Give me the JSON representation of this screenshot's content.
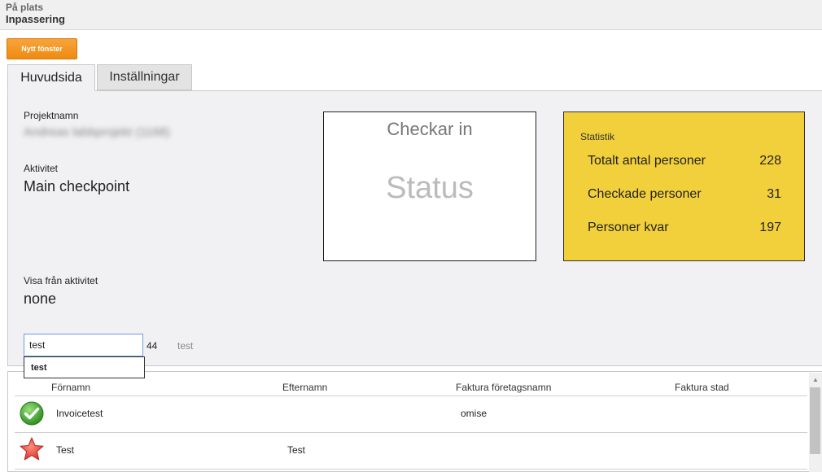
{
  "header": {
    "breadcrumb": "På plats",
    "title": "Inpassering"
  },
  "toolbar": {
    "new_window_label": "Nytt fönster"
  },
  "tabs": [
    {
      "label": "Huvudsida",
      "active": true
    },
    {
      "label": "Inställningar",
      "active": false
    }
  ],
  "project": {
    "label": "Projektnamn",
    "value": "Andreas labbprojekt (1168)"
  },
  "activity": {
    "label": "Aktivitet",
    "value": "Main checkpoint"
  },
  "show_from": {
    "label": "Visa från aktivitet",
    "value": "none"
  },
  "status_box": {
    "title": "Checkar in",
    "status": "Status"
  },
  "stats": {
    "title": "Statistik",
    "rows": [
      {
        "label": "Totalt antal personer",
        "value": "228"
      },
      {
        "label": "Checkade personer",
        "value": "31"
      },
      {
        "label": "Personer kvar",
        "value": "197"
      }
    ],
    "color": "#f2d03b"
  },
  "search": {
    "value": "test",
    "suggestion": "test",
    "result_count": "44",
    "query_echo": "test"
  },
  "table": {
    "columns": [
      "Förnamn",
      "Efternamn",
      "Faktura företagsnamn",
      "Faktura stad"
    ],
    "rows": [
      {
        "icon": "check-icon",
        "first": "Invoicetest",
        "last": "",
        "company": "omise",
        "city": ""
      },
      {
        "icon": "star-icon",
        "first": "Test",
        "last": "Test",
        "company": "",
        "city": ""
      }
    ]
  },
  "colors": {
    "accent": "#ef8a10",
    "check": "#3aa52a",
    "star": "#e6453a"
  }
}
